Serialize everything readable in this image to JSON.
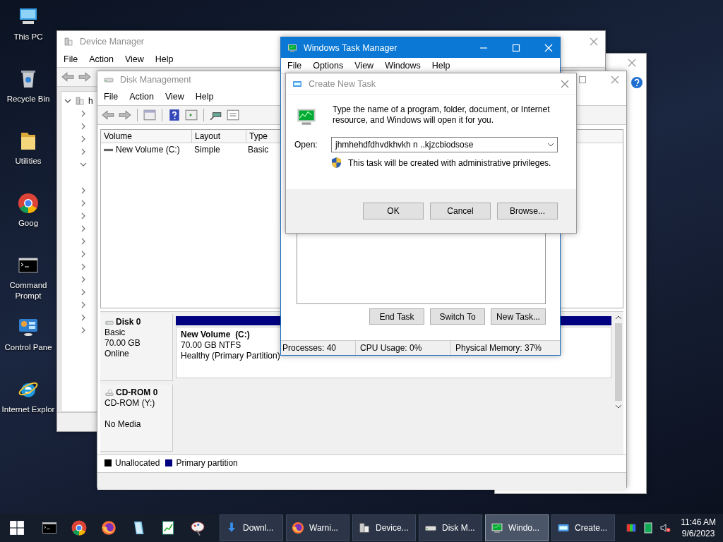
{
  "desktop_icons": [
    {
      "label": "This PC",
      "kind": "pc"
    },
    {
      "label": "Recycle Bin",
      "kind": "recycle"
    },
    {
      "label": "Utilities",
      "kind": "folder"
    },
    {
      "label": "Goog",
      "kind": "chrome"
    },
    {
      "label": "Command Prompt",
      "kind": "cmd"
    },
    {
      "label": "Control Pane",
      "kind": "control"
    },
    {
      "label": "Internet Explor",
      "kind": "ie"
    }
  ],
  "device_manager": {
    "title": "Device Manager",
    "menu": [
      "File",
      "Action",
      "View",
      "Help"
    ],
    "tree": {
      "root": {
        "label": "h",
        "expanded": true
      },
      "items": [
        {
          "expanded": false
        },
        {
          "expanded": false
        },
        {
          "expanded": false
        },
        {
          "expanded": false
        },
        {
          "expanded": true
        },
        {
          "expanded": false
        },
        {
          "expanded": false
        },
        {
          "expanded": false
        },
        {
          "expanded": false
        },
        {
          "expanded": false
        },
        {
          "expanded": false
        },
        {
          "expanded": false
        },
        {
          "expanded": false
        },
        {
          "expanded": false
        },
        {
          "expanded": false
        },
        {
          "expanded": false
        },
        {
          "expanded": false
        }
      ]
    }
  },
  "disk_management": {
    "title": "Disk Management",
    "menu": [
      "File",
      "Action",
      "View",
      "Help"
    ],
    "columns": [
      "Volume",
      "Layout",
      "Type"
    ],
    "rows": [
      {
        "volume": "New Volume (C:)",
        "layout": "Simple",
        "type": "Basic"
      }
    ],
    "disks": [
      {
        "kind": "disk",
        "name": "Disk 0",
        "type": "Basic",
        "size": "70.00 GB",
        "status": "Online",
        "partitions": [
          {
            "name": "New Volume  (C:)",
            "size": "70.00 GB NTFS",
            "status": "Healthy (Primary Partition)"
          }
        ]
      },
      {
        "kind": "cdrom",
        "name": "CD-ROM 0",
        "type": "CD-ROM (Y:)",
        "status": "No Media"
      }
    ],
    "legend": [
      {
        "label": "Unallocated",
        "color": "#000000"
      },
      {
        "label": "Primary partition",
        "color": "#000080"
      }
    ]
  },
  "task_manager": {
    "title": "Windows Task Manager",
    "menu": [
      "File",
      "Options",
      "View",
      "Windows",
      "Help"
    ],
    "buttons": [
      "End Task",
      "Switch To",
      "New Task..."
    ],
    "status_bar": [
      "Processes: 40",
      "CPU Usage: 0%",
      "Physical Memory: 37%"
    ]
  },
  "dialog": {
    "title": "Create New Task",
    "message": "Type the name of a program, folder, document, or Internet resource, and Windows will open it for you.",
    "open_label": "Open:",
    "value": "jhmhehdfdhvdkhvkh n ..kjzcbiodsose",
    "note": "This task will be created with administrative privileges.",
    "buttons": [
      "OK",
      "Cancel",
      "Browse..."
    ]
  },
  "taskbar": {
    "pinned": [
      {
        "kind": "cmd"
      },
      {
        "kind": "chrome"
      },
      {
        "kind": "firefox"
      },
      {
        "kind": "notepad"
      },
      {
        "kind": "chart"
      },
      {
        "kind": "paint"
      }
    ],
    "tasks": [
      {
        "label": "Downl...",
        "kind": "download",
        "selected": false
      },
      {
        "label": "Warni...",
        "kind": "firefox",
        "selected": false
      },
      {
        "label": "Device...",
        "kind": "device",
        "selected": false
      },
      {
        "label": "Disk M...",
        "kind": "disk",
        "selected": false
      },
      {
        "label": "Windo...",
        "kind": "taskmgr",
        "selected": true
      },
      {
        "label": "Create...",
        "kind": "run",
        "selected": false
      }
    ],
    "time": "11:46 AM",
    "date": "9/6/2023"
  }
}
